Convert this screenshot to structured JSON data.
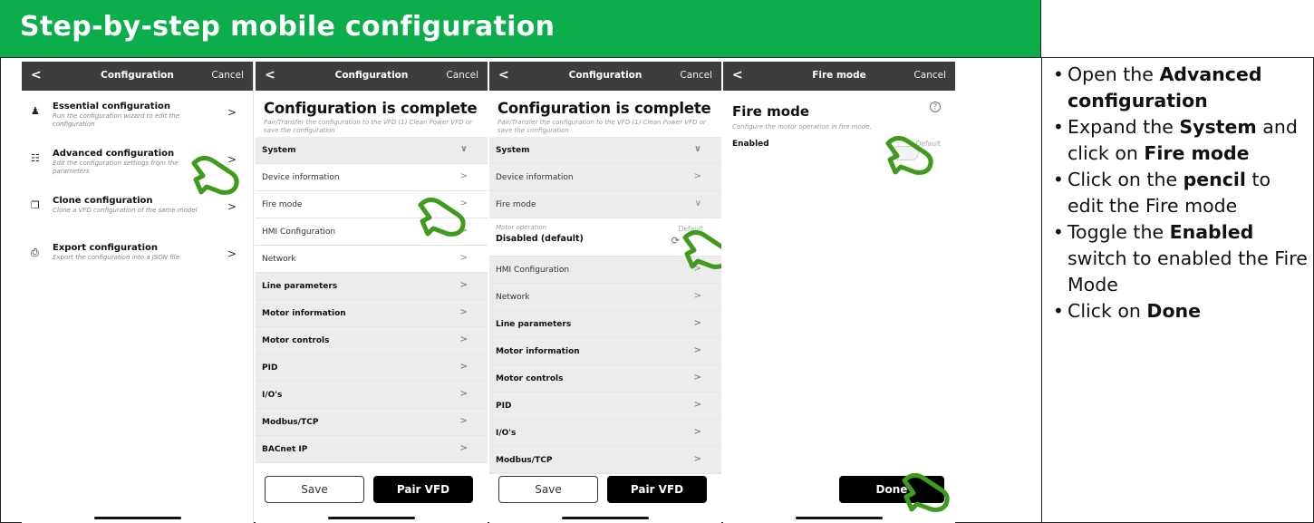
{
  "header": {
    "title": "Step-by-step mobile configuration"
  },
  "colors": {
    "header_green": "#0cad4b",
    "topbar": "#3d3d3d",
    "hand_green": "#3f9a1e"
  },
  "phone1": {
    "title": "Configuration",
    "back": "<",
    "cancel": "Cancel",
    "items": [
      {
        "icon": "person-icon",
        "title": "Essential configuration",
        "desc": "Run the configuration wizard to edit the configuration",
        "chev": ">"
      },
      {
        "icon": "sliders-icon",
        "title": "Advanced configuration",
        "desc": "Edit the configuration settings from the parameters",
        "chev": ">"
      },
      {
        "icon": "copy-icon",
        "title": "Clone configuration",
        "desc": "Clone a VFD configuration of the same model",
        "chev": ">"
      },
      {
        "icon": "export-icon",
        "title": "Export configuration",
        "desc": "Export the configuration into a JSON file",
        "chev": ">"
      }
    ]
  },
  "phone2": {
    "title": "Configuration",
    "back": "<",
    "cancel": "Cancel",
    "heading": "Configuration is complete",
    "sub": "Pair/Transfer the configuration to the VFD (1) Clean Power VFD or save the configuration",
    "rows": [
      {
        "label": "System",
        "chev": "∨"
      },
      {
        "label": "Device information",
        "chev": ">"
      },
      {
        "label": "Fire mode",
        "chev": ">"
      },
      {
        "label": "HMI Configuration",
        "chev": ">"
      },
      {
        "label": "Network",
        "chev": ">"
      },
      {
        "label": "Line parameters",
        "chev": ">"
      },
      {
        "label": "Motor information",
        "chev": ">"
      },
      {
        "label": "Motor controls",
        "chev": ">"
      },
      {
        "label": "PID",
        "chev": ">"
      },
      {
        "label": "I/O's",
        "chev": ">"
      },
      {
        "label": "Modbus/TCP",
        "chev": ">"
      },
      {
        "label": "BACnet IP",
        "chev": ">"
      }
    ],
    "save": "Save",
    "pair": "Pair VFD"
  },
  "phone3": {
    "title": "Configuration",
    "back": "<",
    "cancel": "Cancel",
    "heading": "Configuration is complete",
    "sub": "Pair/Transfer the configuration to the VFD (1) Clean Power VFD or save the configuration",
    "rows_top": [
      {
        "label": "System",
        "chev": "∨"
      },
      {
        "label": "Device information",
        "chev": ">"
      },
      {
        "label": "Fire mode",
        "chev": "∨"
      }
    ],
    "motor_op": {
      "label": "Motor operation",
      "value": "Disabled (default)",
      "default": "Default",
      "reset": "⟳"
    },
    "rows_bottom": [
      {
        "label": "HMI Configuration",
        "chev": ">"
      },
      {
        "label": "Network",
        "chev": ">"
      },
      {
        "label": "Line parameters",
        "chev": ">"
      },
      {
        "label": "Motor information",
        "chev": ">"
      },
      {
        "label": "Motor controls",
        "chev": ">"
      },
      {
        "label": "PID",
        "chev": ">"
      },
      {
        "label": "I/O's",
        "chev": ">"
      },
      {
        "label": "Modbus/TCP",
        "chev": ">"
      }
    ],
    "save": "Save",
    "pair": "Pair VFD"
  },
  "phone4": {
    "title": "Fire mode",
    "back": "<",
    "cancel": "Cancel",
    "heading": "Fire mode",
    "help": "?",
    "desc": "Configure the motor operation in fire mode.",
    "enabled": "Enabled",
    "default": "Default",
    "done": "Done"
  },
  "instructions": [
    {
      "pre": "Open the ",
      "bold": "Advanced configuration",
      "post": ""
    },
    {
      "pre": "Expand the ",
      "bold": "System",
      "post": " and click on ",
      "bold2": "Fire mode"
    },
    {
      "pre": "Click on the ",
      "bold": "pencil",
      "post": " to edit the Fire mode"
    },
    {
      "pre": "Toggle the ",
      "bold": "Enabled",
      "post": " switch to enabled the Fire Mode"
    },
    {
      "pre": "Click on ",
      "bold": "Done",
      "post": ""
    }
  ],
  "bullet": "•"
}
